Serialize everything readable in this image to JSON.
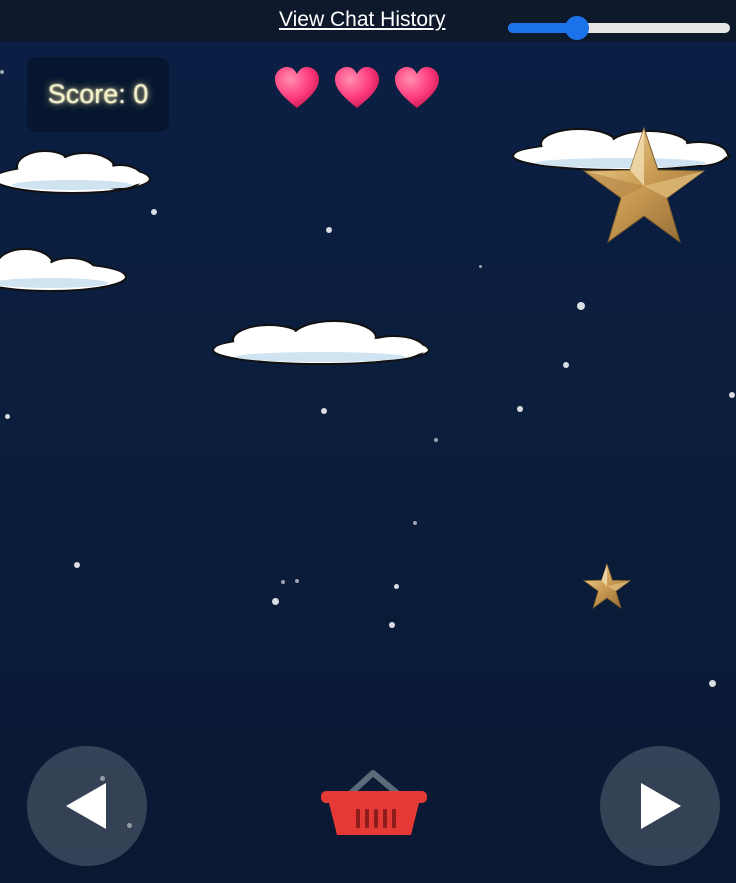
{
  "header": {
    "chat_link_label": "View Chat History"
  },
  "volume_slider": {
    "value_fraction": 0.31,
    "accent_color": "#1a73e8"
  },
  "hud": {
    "score_text": "Score: 0",
    "lives": 3,
    "heart_color": "#ff3d7f"
  },
  "game_objects": {
    "basket": {
      "icon": "basket-icon",
      "color": "#e53935"
    },
    "falling_stars": [
      {
        "icon": "large-gold-star-icon"
      },
      {
        "icon": "small-gold-star-icon"
      }
    ],
    "clouds": 4
  },
  "controls": {
    "left_icon": "left-arrow-icon",
    "right_icon": "right-arrow-icon"
  },
  "colors": {
    "sky": "#0b1e3d",
    "topbar": "#0e1a2c",
    "star_gold": "#d9b26a"
  }
}
